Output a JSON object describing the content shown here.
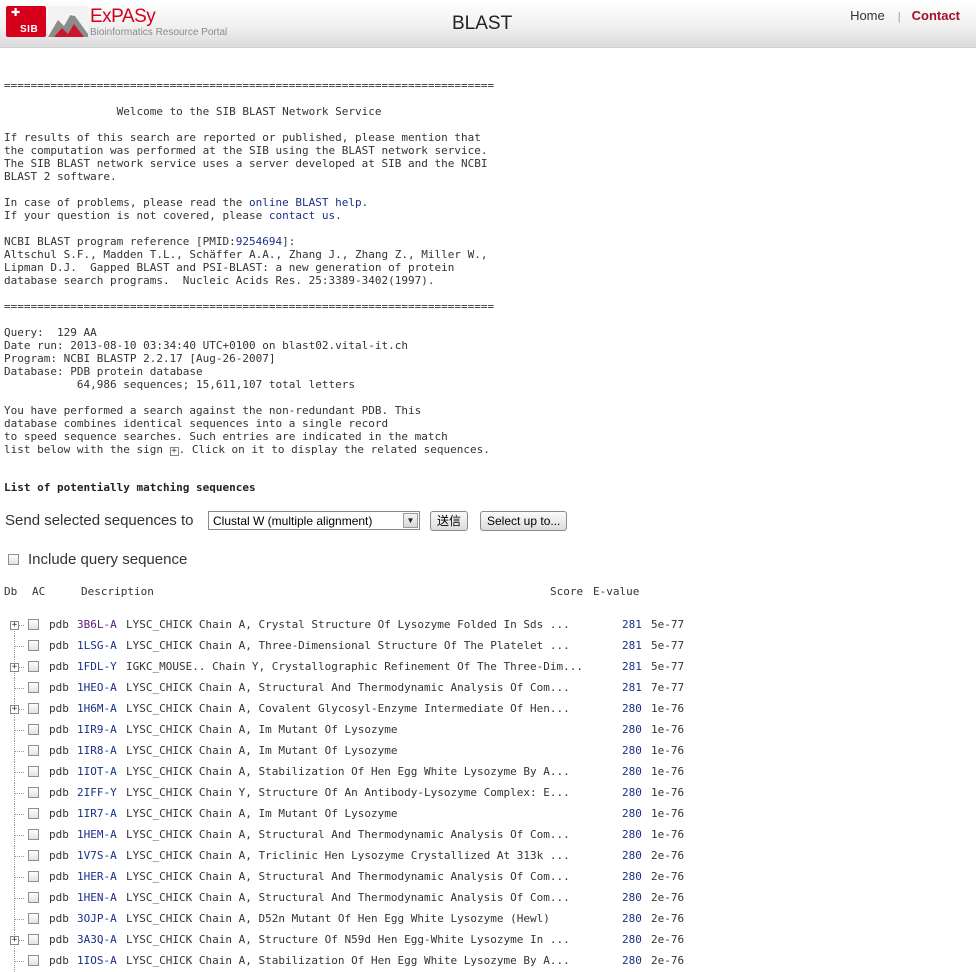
{
  "header": {
    "logo_sib": "SIB",
    "logo_name": "ExPASy",
    "logo_subtitle": "Bioinformatics Resource Portal",
    "title": "BLAST",
    "nav_home": "Home",
    "nav_separator": "|",
    "nav_contact": "Contact",
    "accent_color": "#d6001c"
  },
  "intro": {
    "rule": "==========================================================================",
    "welcome": "                 Welcome to the SIB BLAST Network Service",
    "citation_lines": [
      "If results of this search are reported or published, please mention that",
      "the computation was performed at the SIB using the BLAST network service.",
      "The SIB BLAST network service uses a server developed at SIB and the NCBI",
      "BLAST 2 software."
    ],
    "help_prefix": "In case of problems, please read the ",
    "help_link": "online BLAST help",
    "help_suffix": ".",
    "contact_prefix": "If your question is not covered, please ",
    "contact_link": "contact us",
    "contact_suffix": ".",
    "ref_prefix": "NCBI BLAST program reference [PMID:",
    "ref_pmid": "9254694",
    "ref_suffix": "]:",
    "ref_lines": [
      "Altschul S.F., Madden T.L., Schäffer A.A., Zhang J., Zhang Z., Miller W.,",
      "Lipman D.J.  Gapped BLAST and PSI-BLAST: a new generation of protein",
      "database search programs.  Nucleic Acids Res. 25:3389-3402(1997)."
    ],
    "rule2": "==========================================================================",
    "query_lines": [
      "Query:  129 AA",
      "Date run: 2013-08-10 03:34:40 UTC+0100 on blast02.vital-it.ch",
      "Program: NCBI BLASTP 2.2.17 [Aug-26-2007]",
      "Database: PDB protein database",
      "           64,986 sequences; 15,611,107 total letters"
    ],
    "nr_lines": [
      "You have performed a search against the non-redundant PDB. This",
      "database combines identical sequences into a single record",
      "to speed sequence searches. Such entries are indicated in the match"
    ],
    "nr_last_prefix": "list below with the sign ",
    "nr_last_sign": "+",
    "nr_last_suffix": ". Click on it to display the related sequences."
  },
  "list": {
    "title": "List of potentially matching sequences",
    "send_label": "Send selected sequences to",
    "send_target": "Clustal W (multiple alignment)",
    "submit_label": "送信",
    "select_label": "Select up to...",
    "include_label": "Include query sequence",
    "col_db": "Db",
    "col_ac": "AC",
    "col_desc": "Description",
    "col_score": "Score",
    "col_evalue": "E-value"
  },
  "results": [
    {
      "expand": true,
      "db": "pdb",
      "ac": "3B6L-A",
      "visited": true,
      "desc": "LYSC_CHICK Chain A, Crystal Structure Of Lysozyme Folded In Sds ...",
      "score": "281",
      "evalue": "5e-77"
    },
    {
      "expand": false,
      "db": "pdb",
      "ac": "1LSG-A",
      "visited": false,
      "desc": "LYSC_CHICK Chain A, Three-Dimensional Structure Of The Platelet  ...",
      "score": "281",
      "evalue": "5e-77"
    },
    {
      "expand": true,
      "db": "pdb",
      "ac": "1FDL-Y",
      "visited": false,
      "desc": "IGKC_MOUSE.. Chain Y, Crystallographic Refinement Of The Three-Dim...",
      "score": "281",
      "evalue": "5e-77"
    },
    {
      "expand": false,
      "db": "pdb",
      "ac": "1HEO-A",
      "visited": false,
      "desc": "LYSC_CHICK Chain A, Structural And Thermodynamic Analysis Of Com...",
      "score": "281",
      "evalue": "7e-77"
    },
    {
      "expand": true,
      "db": "pdb",
      "ac": "1H6M-A",
      "visited": false,
      "desc": "LYSC_CHICK Chain A, Covalent Glycosyl-Enzyme Intermediate Of Hen...",
      "score": "280",
      "evalue": "1e-76"
    },
    {
      "expand": false,
      "db": "pdb",
      "ac": "1IR9-A",
      "visited": false,
      "desc": "LYSC_CHICK Chain A, Im Mutant Of Lysozyme",
      "score": "280",
      "evalue": "1e-76"
    },
    {
      "expand": false,
      "db": "pdb",
      "ac": "1IR8-A",
      "visited": false,
      "desc": "LYSC_CHICK Chain A, Im Mutant Of Lysozyme",
      "score": "280",
      "evalue": "1e-76"
    },
    {
      "expand": false,
      "db": "pdb",
      "ac": "1IOT-A",
      "visited": false,
      "desc": "LYSC_CHICK Chain A, Stabilization Of Hen Egg White Lysozyme By A...",
      "score": "280",
      "evalue": "1e-76"
    },
    {
      "expand": false,
      "db": "pdb",
      "ac": "2IFF-Y",
      "visited": false,
      "desc": "LYSC_CHICK Chain Y, Structure Of An Antibody-Lysozyme Complex: E...",
      "score": "280",
      "evalue": "1e-76"
    },
    {
      "expand": false,
      "db": "pdb",
      "ac": "1IR7-A",
      "visited": false,
      "desc": "LYSC_CHICK Chain A, Im Mutant Of Lysozyme",
      "score": "280",
      "evalue": "1e-76"
    },
    {
      "expand": false,
      "db": "pdb",
      "ac": "1HEM-A",
      "visited": false,
      "desc": "LYSC_CHICK Chain A, Structural And Thermodynamic Analysis Of Com...",
      "score": "280",
      "evalue": "1e-76"
    },
    {
      "expand": false,
      "db": "pdb",
      "ac": "1V7S-A",
      "visited": false,
      "desc": "LYSC_CHICK Chain A, Triclinic Hen Lysozyme Crystallized At 313k ...",
      "score": "280",
      "evalue": "2e-76"
    },
    {
      "expand": false,
      "db": "pdb",
      "ac": "1HER-A",
      "visited": false,
      "desc": "LYSC_CHICK Chain A, Structural And Thermodynamic Analysis Of Com...",
      "score": "280",
      "evalue": "2e-76"
    },
    {
      "expand": false,
      "db": "pdb",
      "ac": "1HEN-A",
      "visited": false,
      "desc": "LYSC_CHICK Chain A, Structural And Thermodynamic Analysis Of Com...",
      "score": "280",
      "evalue": "2e-76"
    },
    {
      "expand": false,
      "db": "pdb",
      "ac": "3OJP-A",
      "visited": false,
      "desc": "LYSC_CHICK Chain A, D52n Mutant Of Hen Egg White Lysozyme (Hewl)",
      "score": "280",
      "evalue": "2e-76"
    },
    {
      "expand": true,
      "db": "pdb",
      "ac": "3A3Q-A",
      "visited": false,
      "desc": "LYSC_CHICK Chain A, Structure Of N59d Hen Egg-White Lysozyme In ...",
      "score": "280",
      "evalue": "2e-76"
    },
    {
      "expand": false,
      "db": "pdb",
      "ac": "1IOS-A",
      "visited": false,
      "desc": "LYSC_CHICK Chain A, Stabilization Of Hen Egg White Lysozyme By A...",
      "score": "280",
      "evalue": "2e-76"
    }
  ]
}
